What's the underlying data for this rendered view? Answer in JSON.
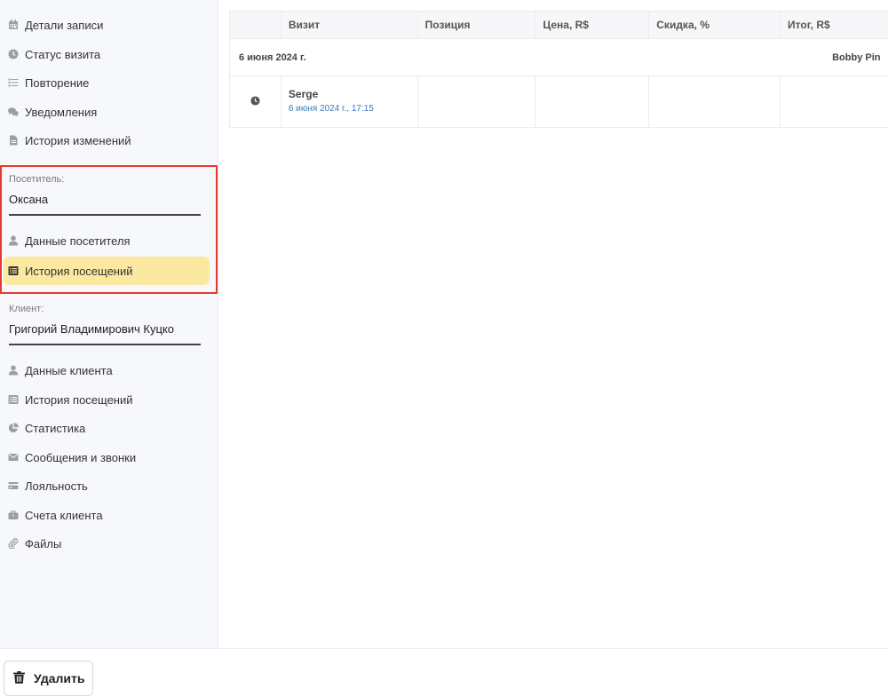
{
  "sidebar": {
    "record_items": [
      {
        "label": "Детали записи",
        "icon": "calendar-icon"
      },
      {
        "label": "Статус визита",
        "icon": "clock-icon"
      },
      {
        "label": "Повторение",
        "icon": "list-icon"
      },
      {
        "label": "Уведомления",
        "icon": "chat-icon"
      },
      {
        "label": "История изменений",
        "icon": "document-icon"
      }
    ],
    "visitor": {
      "label": "Посетитель:",
      "name": "Оксана",
      "items": [
        {
          "label": "Данные посетителя",
          "icon": "user-icon"
        },
        {
          "label": "История посещений",
          "icon": "list-alt-icon",
          "active": true
        }
      ]
    },
    "client": {
      "label": "Клиент:",
      "name": "Григорий  Владимирович Куцко",
      "items": [
        {
          "label": "Данные клиента",
          "icon": "user-icon"
        },
        {
          "label": "История посещений",
          "icon": "list-alt-icon"
        },
        {
          "label": "Статистика",
          "icon": "pie-chart-icon"
        },
        {
          "label": "Сообщения и звонки",
          "icon": "envelope-icon"
        },
        {
          "label": "Лояльность",
          "icon": "credit-card-icon"
        },
        {
          "label": "Счета клиента",
          "icon": "briefcase-icon"
        },
        {
          "label": "Файлы",
          "icon": "paperclip-icon"
        }
      ]
    }
  },
  "table": {
    "headers": [
      "",
      "Визит",
      "Позиция",
      "Цена, R$",
      "Скидка, %",
      "Итог, R$"
    ],
    "date_row": {
      "date": "6 июня 2024 г.",
      "staff": "Bobby Pin"
    },
    "visit": {
      "name": "Serge",
      "datetime": "6 июня 2024 г., 17:15"
    }
  },
  "footer": {
    "delete_label": "Удалить"
  },
  "colors": {
    "active_bg": "#fbe9a2",
    "highlight_border": "#e53b2c",
    "link": "#3a78b8"
  }
}
